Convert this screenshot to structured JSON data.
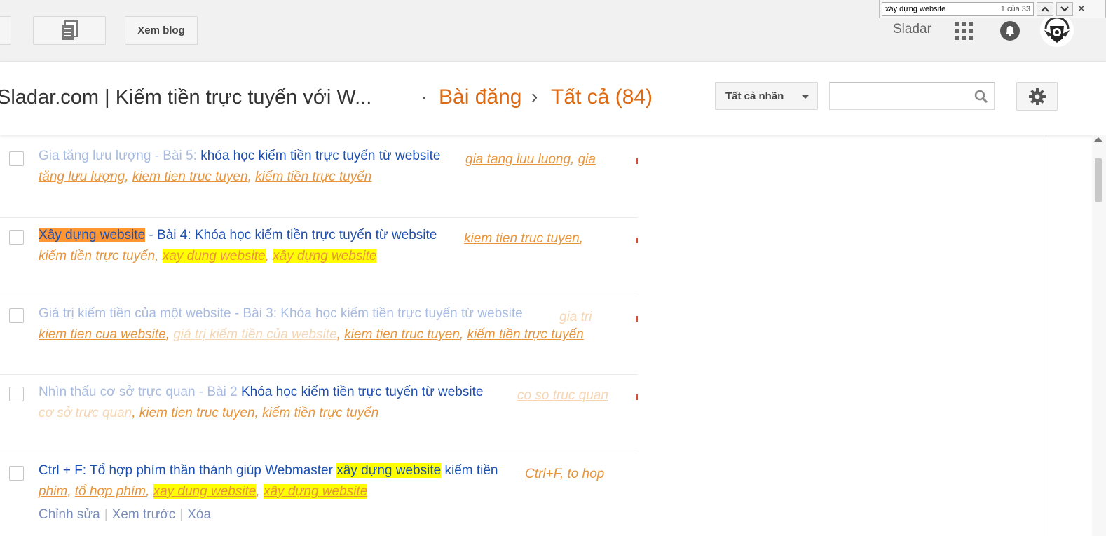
{
  "toolbar": {
    "view_blog_label": "Xem blog",
    "user_name": "Sladar"
  },
  "find": {
    "query": "xây dựng website",
    "count": "1 của 33"
  },
  "header": {
    "blog_title": "Sladar.com | Kiếm tiền trực tuyến với W...",
    "separator": "·",
    "crumb_posts": "Bài đăng",
    "crumb_arrow": "›",
    "crumb_all": "Tất cả (84)",
    "labels_dropdown": "Tất cả nhãn"
  },
  "posts": [
    {
      "title_lead": "Gia tăng lưu lượng - Bài 5: ",
      "title_rest": "khóa học kiếm tiền trực tuyến từ website",
      "labels_line1": [
        "gia tang luu luong",
        "gia"
      ],
      "labels_line2": [
        "tăng lưu lượng",
        "kiem tien truc tuyen",
        "kiếm tiền trực tuyến"
      ]
    },
    {
      "title_highlight": "Xây dựng website",
      "title_rest": " - Bài 4: Khóa học kiếm tiền trực tuyến từ website",
      "labels_line1": [
        "kiem tien truc tuyen"
      ],
      "labels_line2": [
        "kiếm tiền trực tuyến",
        "xay dung website",
        "xây dựng website"
      ]
    },
    {
      "title_lead": "Giá trị kiếm tiền của một website - Bài 3: ",
      "title_rest": "Khóa học kiếm tiền trực tuyến từ website",
      "labels_line1": [
        "gia tri"
      ],
      "labels_line2": [
        "kiem tien cua website",
        "giá trị kiếm tiền của website",
        "kiem tien truc tuyen",
        "kiếm tiền trực tuyến"
      ]
    },
    {
      "title_lead": "Nhìn thấu cơ sở trực quan - Bài 2 ",
      "title_rest": "Khóa học kiếm tiền trực tuyến từ website",
      "labels_line1": [
        "co so truc quan"
      ],
      "labels_line2": [
        "cơ sở trực quan",
        "kiem tien truc tuyen",
        "kiếm tiền trực tuyến"
      ]
    },
    {
      "title_lead": "Ctrl + F: Tổ hợp phím thần thánh giúp Webmaster ",
      "title_highlight": "xây dựng website",
      "title_tail": " kiếm tiền",
      "labels_line1": [
        "Ctrl+F",
        "to hop"
      ],
      "labels_line2": [
        "phim",
        "tổ hợp phím",
        "xay dung website",
        "xây dựng website"
      ]
    }
  ],
  "row_actions": {
    "edit": "Chỉnh sửa",
    "preview": "Xem trước",
    "delete": "Xóa"
  },
  "colors": {
    "accent": "#dd6a12",
    "link": "#1c4fb0",
    "label": "#e7943b",
    "highlight": "#ffff00",
    "current_match": "#ff9632"
  }
}
